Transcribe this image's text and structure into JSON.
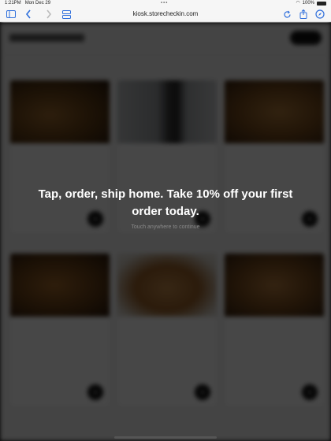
{
  "status_bar": {
    "time": "1:21PM",
    "date": "Mon Dec 29",
    "dots": "•••",
    "battery_text": "100%"
  },
  "browser": {
    "url": "kiosk.storecheckin.com",
    "icons": {
      "sidebar": "sidebar-icon",
      "back": "chevron-left-icon",
      "forward": "chevron-right-icon",
      "tabs": "tabs-icon",
      "reload": "reload-icon",
      "share": "share-icon",
      "compass": "compass-icon"
    }
  },
  "overlay": {
    "headline": "Tap, order, ship home. Take 10% off your first order today.",
    "subtext": "Touch anywhere to continue"
  },
  "colors": {
    "accent": "#2f6fdc",
    "overlay": "#000000",
    "headline": "#ffffff",
    "subtext": "#8a8a8a"
  }
}
